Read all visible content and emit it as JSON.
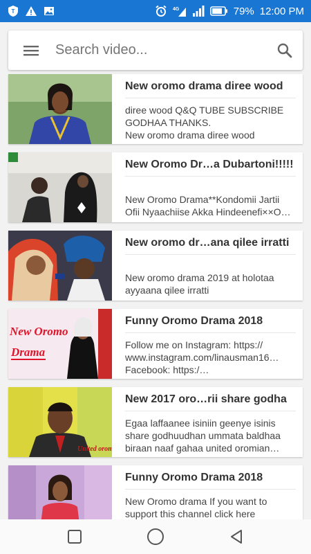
{
  "status": {
    "battery": "79%",
    "time": "12:00 PM",
    "network": "4G"
  },
  "search": {
    "placeholder": "Search video..."
  },
  "videos": [
    {
      "title": "New oromo drama diree wood",
      "desc": "diree wood Q&Q TUBE SUBSCRIBE GODHAA THANKS.\nNew oromo drama diree wood"
    },
    {
      "title": "New Oromo Dr…a Dubartoni!!!!!",
      "desc": "New Oromo Drama**Kondomii Jartii Ofii Nyaachiise Akka Hindeenefi××O…",
      "thumb_text": ""
    },
    {
      "title": "New oromo dr…ana qilee irratti",
      "desc": "New oromo drama 2019 at holotaa ayyaana qilee irratti"
    },
    {
      "title": "Funny Oromo Drama 2018",
      "desc": "Follow me on Instagram: https://\nwww.instagram.com/linausman16…\nFacebook: https:/…",
      "thumb_text": "New Oromo\nDrama"
    },
    {
      "title": "New 2017 oro…rii share godha",
      "desc": "Egaa laffaanee isiniin geenye isinis share godhuudhan ummata baldhaa biraan naaf gahaa united oromian…",
      "thumb_text": "United oromia"
    },
    {
      "title": "Funny Oromo Drama 2018",
      "desc": "New Oromo drama If you want to support this channel click here"
    }
  ],
  "colors": {
    "status_bar": "#1976d2",
    "card": "#ffffff",
    "background": "#f2f2f2"
  }
}
